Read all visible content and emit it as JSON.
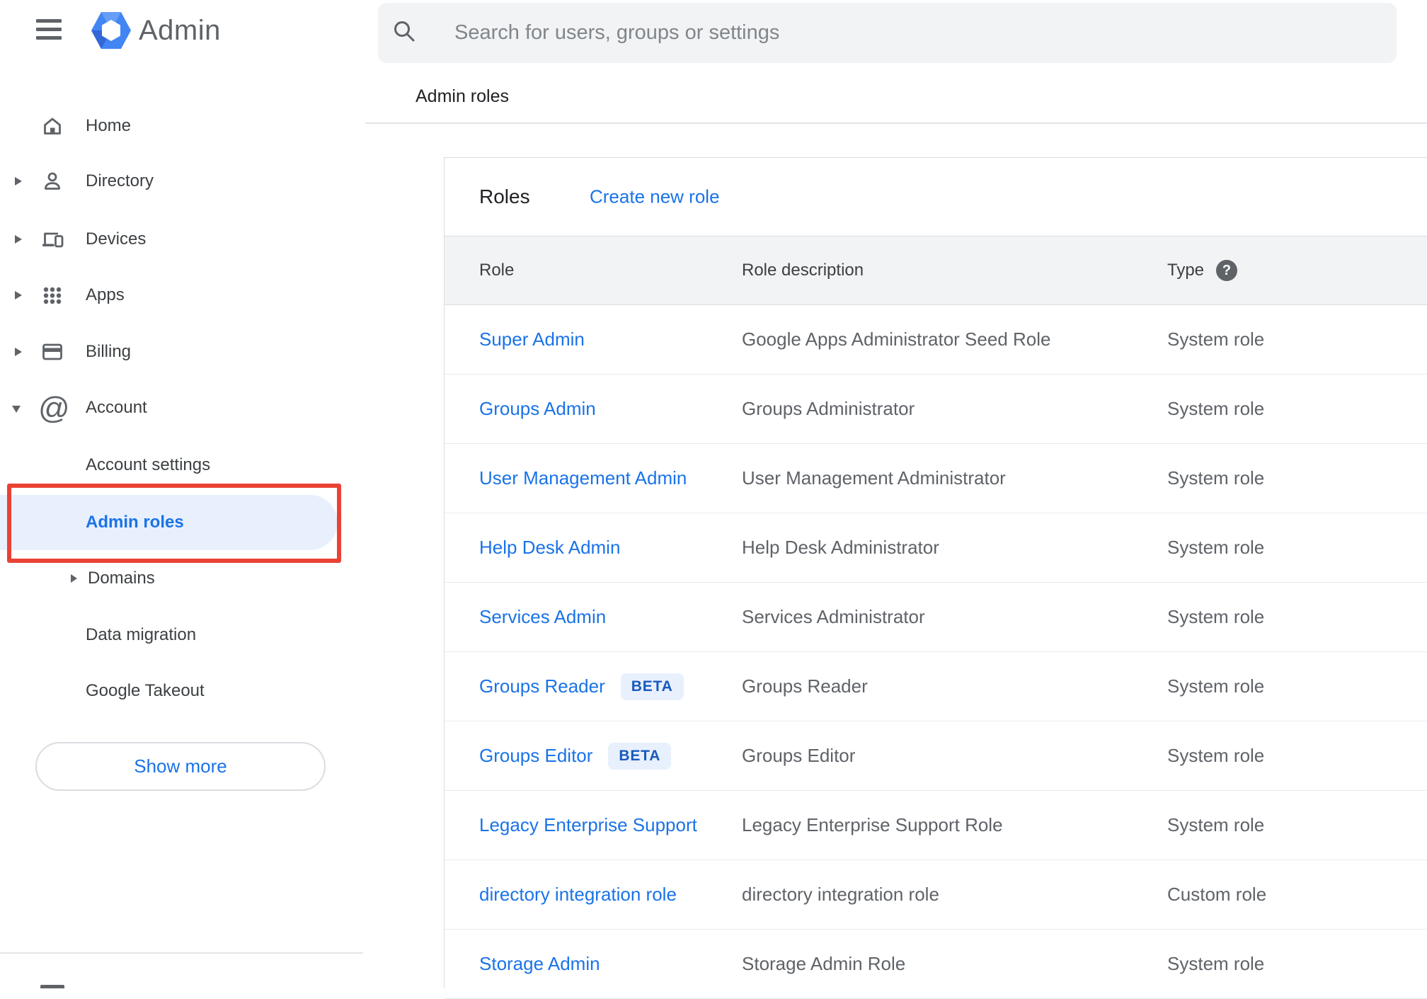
{
  "brand": {
    "app_name": "Admin"
  },
  "search": {
    "placeholder": "Search for users, groups or settings"
  },
  "page": {
    "breadcrumb": "Admin roles"
  },
  "sidebar": {
    "items": [
      {
        "label": "Home"
      },
      {
        "label": "Directory"
      },
      {
        "label": "Devices"
      },
      {
        "label": "Apps"
      },
      {
        "label": "Billing"
      },
      {
        "label": "Account"
      },
      {
        "label": "Account settings"
      },
      {
        "label": "Admin roles"
      },
      {
        "label": "Domains"
      },
      {
        "label": "Data migration"
      },
      {
        "label": "Google Takeout"
      }
    ],
    "show_more_label": "Show more"
  },
  "roles": {
    "title": "Roles",
    "create_link_label": "Create new role",
    "columns": {
      "role": "Role",
      "description": "Role description",
      "type": "Type"
    },
    "help_glyph": "?",
    "rows": [
      {
        "name": "Super Admin",
        "description": "Google Apps Administrator Seed Role",
        "type": "System role"
      },
      {
        "name": "Groups Admin",
        "description": "Groups Administrator",
        "type": "System role"
      },
      {
        "name": "User Management Admin",
        "description": "User Management Administrator",
        "type": "System role"
      },
      {
        "name": "Help Desk Admin",
        "description": "Help Desk Administrator",
        "type": "System role"
      },
      {
        "name": "Services Admin",
        "description": "Services Administrator",
        "type": "System role"
      },
      {
        "name": "Groups Reader",
        "badge": "BETA",
        "description": "Groups Reader",
        "type": "System role"
      },
      {
        "name": "Groups Editor",
        "badge": "BETA",
        "description": "Groups Editor",
        "type": "System role"
      },
      {
        "name": "Legacy Enterprise Support",
        "description": "Legacy Enterprise Support Role",
        "type": "System role"
      },
      {
        "name": "directory integration role",
        "description": "directory integration role",
        "type": "Custom role"
      },
      {
        "name": "Storage Admin",
        "description": "Storage Admin Role",
        "type": "System role"
      }
    ]
  },
  "colors": {
    "accent_blue": "#1a73e8",
    "annotation_red": "#e94235",
    "highlight_bg": "#e8f0fe",
    "badge_text": "#185abc",
    "band_gray": "#f1f3f4",
    "icon_gray": "#5f6368"
  }
}
